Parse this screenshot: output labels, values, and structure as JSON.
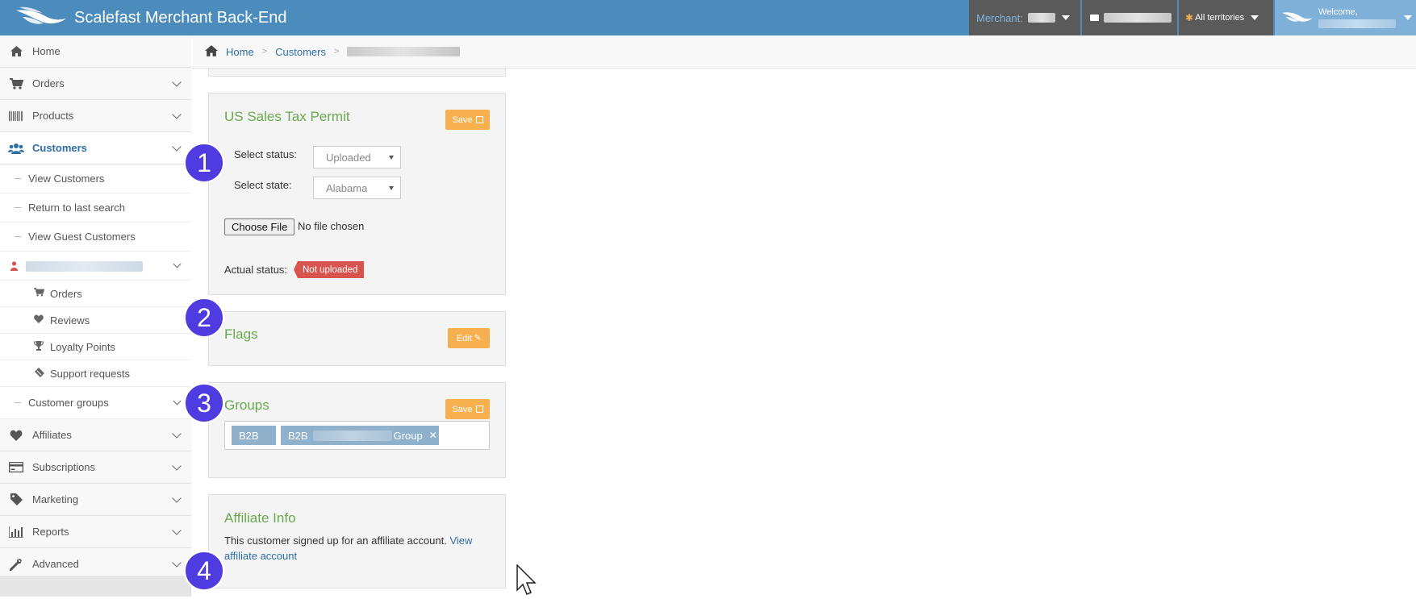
{
  "topbar": {
    "brand": "Scalefast Merchant Back-End",
    "merchant_label": "Merchant:",
    "territory_label": "All territories",
    "welcome_label": "Welcome,"
  },
  "sidebar": {
    "items": [
      {
        "label": "Home",
        "icon": "home-icon"
      },
      {
        "label": "Orders",
        "icon": "cart-icon"
      },
      {
        "label": "Products",
        "icon": "barcode-icon"
      },
      {
        "label": "Customers",
        "icon": "users-icon"
      },
      {
        "label": "Affiliates",
        "icon": "heart-icon"
      },
      {
        "label": "Subscriptions",
        "icon": "credit-card-icon"
      },
      {
        "label": "Marketing",
        "icon": "tag-icon"
      },
      {
        "label": "Reports",
        "icon": "bar-chart-icon"
      },
      {
        "label": "Advanced",
        "icon": "wrench-icon"
      }
    ],
    "customers_sub": [
      "View Customers",
      "Return to last search",
      "View Guest Customers"
    ],
    "customer_detail_sub": [
      {
        "label": "Orders",
        "icon": "cart-icon"
      },
      {
        "label": "Reviews",
        "icon": "heart-icon"
      },
      {
        "label": "Loyalty Points",
        "icon": "trophy-icon"
      },
      {
        "label": "Support requests",
        "icon": "ticket-icon"
      }
    ],
    "customer_groups": "Customer groups"
  },
  "breadcrumb": {
    "home": "Home",
    "customers": "Customers"
  },
  "tax_permit": {
    "title": "US Sales Tax Permit",
    "save": "Save",
    "status_label": "Select status:",
    "status_value": "Uploaded",
    "state_label": "Select state:",
    "state_value": "Alabama",
    "file_button": "Choose File",
    "file_status": "No file chosen",
    "actual_status_label": "Actual status:",
    "actual_status_value": "Not uploaded"
  },
  "flags": {
    "title": "Flags",
    "edit": "Edit"
  },
  "groups": {
    "title": "Groups",
    "save": "Save",
    "tags": [
      "B2B",
      "B2B",
      "Group"
    ]
  },
  "affiliate": {
    "title": "Affiliate Info",
    "text": "This customer signed up for an affiliate account.",
    "link": "View affiliate account"
  },
  "steps": [
    "1",
    "2",
    "3",
    "4"
  ],
  "colors": {
    "topbar": "#4b8cbd",
    "accent_green": "#6aa84f",
    "orange_button": "#f7b04f",
    "danger": "#d9534f",
    "step_badge": "#4f3ce0"
  }
}
